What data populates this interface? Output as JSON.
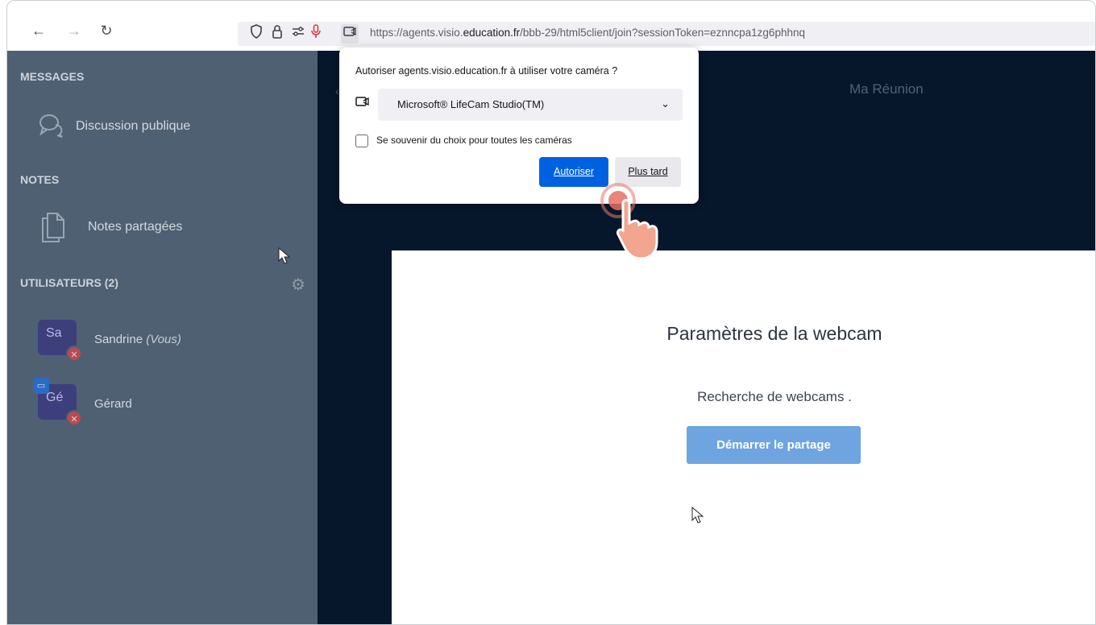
{
  "browser": {
    "url_domain_prefix": "https://agents.visio.",
    "url_domain_main": "education.fr",
    "url_path": "/bbb-29/html5client/join?sessionToken=eznncpa1zg6phhnq"
  },
  "sidebar": {
    "messages_header": "MESSAGES",
    "public_chat_label": "Discussion publique",
    "notes_header": "NOTES",
    "shared_notes_label": "Notes partagées",
    "users_header": "UTILISATEURS (2)",
    "users": [
      {
        "initials": "Sa",
        "name": "Sandrine",
        "suffix": "(Vous)"
      },
      {
        "initials": "Gé",
        "name": "Gérard",
        "suffix": ""
      }
    ]
  },
  "main": {
    "meeting_title": "Ma Réunion",
    "modal_title": "Paramètres de la webcam",
    "modal_status": "Recherche de webcams .",
    "share_button": "Démarrer le partage"
  },
  "permission_popup": {
    "question": "Autoriser agents.visio.education.fr à utiliser votre caméra ?",
    "camera_selected": "Microsoft® LifeCam Studio(TM)",
    "remember_label": "Se souvenir du choix pour toutes les caméras",
    "allow_button": "Autoriser",
    "later_button": "Plus tard"
  },
  "colors": {
    "sidebar_bg": "#4f6072",
    "main_bg": "#06172b",
    "primary_button": "#0061e0",
    "share_button": "#6ea4e0"
  }
}
